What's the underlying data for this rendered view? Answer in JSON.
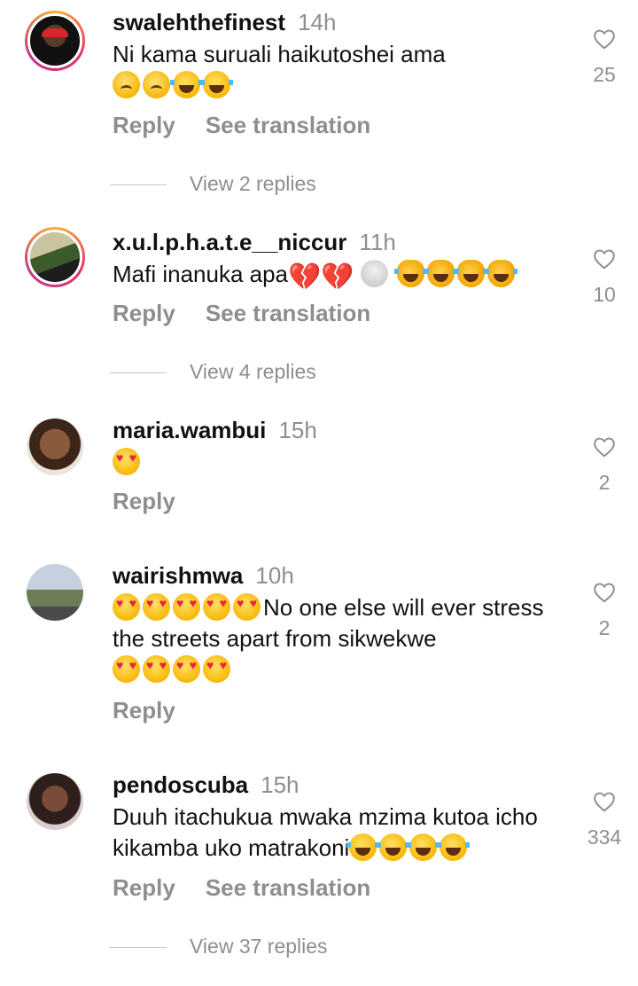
{
  "comments": [
    {
      "username": "swalehthefinest",
      "time": "14h",
      "text": "Ni kama suruali haikutoshei ama",
      "likes": "25",
      "reply": "Reply",
      "translate": "See translation",
      "view_replies": "View 2 replies"
    },
    {
      "username": "x.u.l.p.h.a.t.e__niccur",
      "time": "11h",
      "text": "Mafi inanuka apa",
      "likes": "10",
      "reply": "Reply",
      "translate": "See translation",
      "view_replies": "View 4 replies"
    },
    {
      "username": "maria.wambui",
      "time": "15h",
      "text": "",
      "likes": "2",
      "reply": "Reply"
    },
    {
      "username": "wairishmwa",
      "time": "10h",
      "text": "No one else will ever stress the streets apart from sikwekwe",
      "likes": "2",
      "reply": "Reply"
    },
    {
      "username": "pendoscuba",
      "time": "15h",
      "text": "Duuh itachukua mwaka mzima kutoa icho kikamba uko matrakoni",
      "likes": "334",
      "reply": "Reply",
      "translate": "See translation",
      "view_replies": "View 37 replies"
    }
  ],
  "icons": {
    "like": "heart-outline-icon"
  },
  "colors": {
    "muted": "#8e8e8e",
    "text": "#111111",
    "divider": "#c7c7c7"
  }
}
